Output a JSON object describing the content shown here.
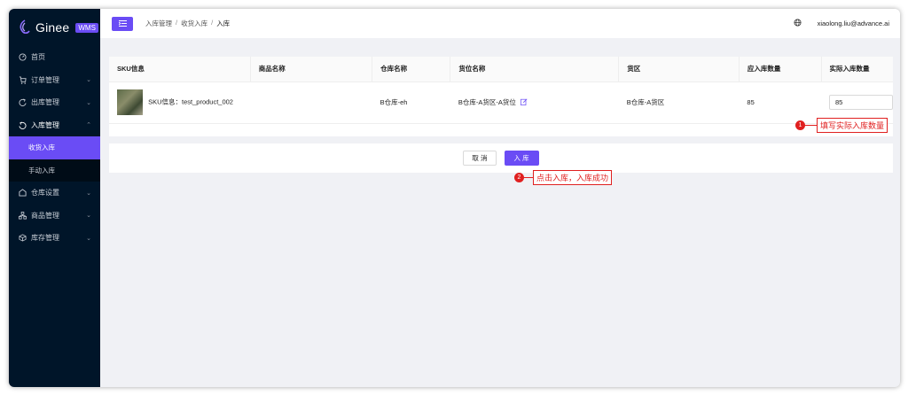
{
  "app": {
    "logo_text": "Ginee",
    "logo_badge": "WMS"
  },
  "sidebar": {
    "items": [
      {
        "label": "首页",
        "icon": "dashboard-icon",
        "chevron": ""
      },
      {
        "label": "订单管理",
        "icon": "cart-icon",
        "chevron": "⌄"
      },
      {
        "label": "出库管理",
        "icon": "outbound-icon",
        "chevron": "⌄"
      },
      {
        "label": "入库管理",
        "icon": "inbound-icon",
        "chevron": "⌃"
      }
    ],
    "sub_items": [
      {
        "label": "收货入库",
        "active": true
      },
      {
        "label": "手动入库",
        "active": false
      }
    ],
    "items_after": [
      {
        "label": "仓库设置",
        "icon": "warehouse-icon",
        "chevron": "⌄"
      },
      {
        "label": "商品管理",
        "icon": "product-icon",
        "chevron": "⌄"
      },
      {
        "label": "库存管理",
        "icon": "inventory-icon",
        "chevron": "⌄"
      }
    ]
  },
  "header": {
    "breadcrumb": [
      "入库管理",
      "收货入库",
      "入库"
    ],
    "separator": "/",
    "user_email": "xiaolong.liu@advance.ai"
  },
  "table": {
    "columns": [
      "SKU信息",
      "商品名称",
      "仓库名称",
      "货位名称",
      "货区",
      "应入库数量",
      "实际入库数量"
    ],
    "rows": [
      {
        "sku": "SKU信息：test_product_002",
        "product_name": "",
        "warehouse": "B仓库-eh",
        "location": "B仓库-A货区-A货位",
        "zone": "B仓库-A货区",
        "expected_qty": "85",
        "actual_qty": "85"
      }
    ]
  },
  "actions": {
    "cancel_label": "取 消",
    "confirm_label": "入 库"
  },
  "annotations": [
    {
      "num": "1",
      "text": "填写实际入库数量"
    },
    {
      "num": "2",
      "text": "点击入库，入库成功"
    }
  ],
  "colors": {
    "accent": "#6a4cf5",
    "sidebar_bg": "#001529",
    "annotation": "#e02020"
  }
}
